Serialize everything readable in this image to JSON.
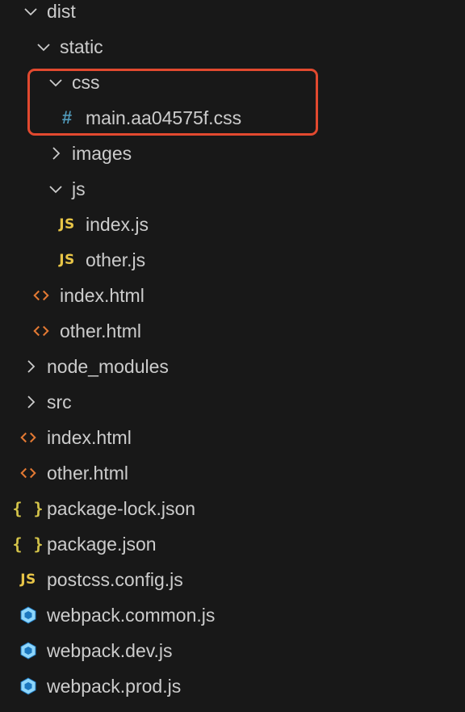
{
  "explorer": {
    "items": [
      {
        "label": "dist",
        "type": "folder",
        "expanded": true,
        "depth": 0
      },
      {
        "label": "static",
        "type": "folder",
        "expanded": true,
        "depth": 1
      },
      {
        "label": "css",
        "type": "folder",
        "expanded": true,
        "depth": 2
      },
      {
        "label": "main.aa04575f.css",
        "type": "css",
        "depth": 3
      },
      {
        "label": "images",
        "type": "folder",
        "expanded": false,
        "depth": 2
      },
      {
        "label": "js",
        "type": "folder",
        "expanded": true,
        "depth": 2
      },
      {
        "label": "index.js",
        "type": "js",
        "depth": 3
      },
      {
        "label": "other.js",
        "type": "js",
        "depth": 3
      },
      {
        "label": "index.html",
        "type": "html",
        "depth": 1
      },
      {
        "label": "other.html",
        "type": "html",
        "depth": 1
      },
      {
        "label": "node_modules",
        "type": "folder",
        "expanded": false,
        "depth": 0
      },
      {
        "label": "src",
        "type": "folder",
        "expanded": false,
        "depth": 0
      },
      {
        "label": "index.html",
        "type": "html",
        "depth": 0
      },
      {
        "label": "other.html",
        "type": "html",
        "depth": 0
      },
      {
        "label": "package-lock.json",
        "type": "json",
        "depth": 0
      },
      {
        "label": "package.json",
        "type": "json",
        "depth": 0
      },
      {
        "label": "postcss.config.js",
        "type": "js",
        "depth": 0
      },
      {
        "label": "webpack.common.js",
        "type": "webpack",
        "depth": 0
      },
      {
        "label": "webpack.dev.js",
        "type": "webpack",
        "depth": 0
      },
      {
        "label": "webpack.prod.js",
        "type": "webpack",
        "depth": 0
      }
    ]
  },
  "icons": {
    "js_glyph": "JS",
    "css_glyph": "#",
    "json_glyph": "{ }"
  },
  "colors": {
    "background": "#181818",
    "text": "#cccccc",
    "js_icon": "#e8c547",
    "css_icon": "#519aba",
    "html_icon": "#e37933",
    "json_icon": "#d4c44a",
    "webpack_icon": "#8ed6fb",
    "highlight_border": "#e2492f"
  }
}
